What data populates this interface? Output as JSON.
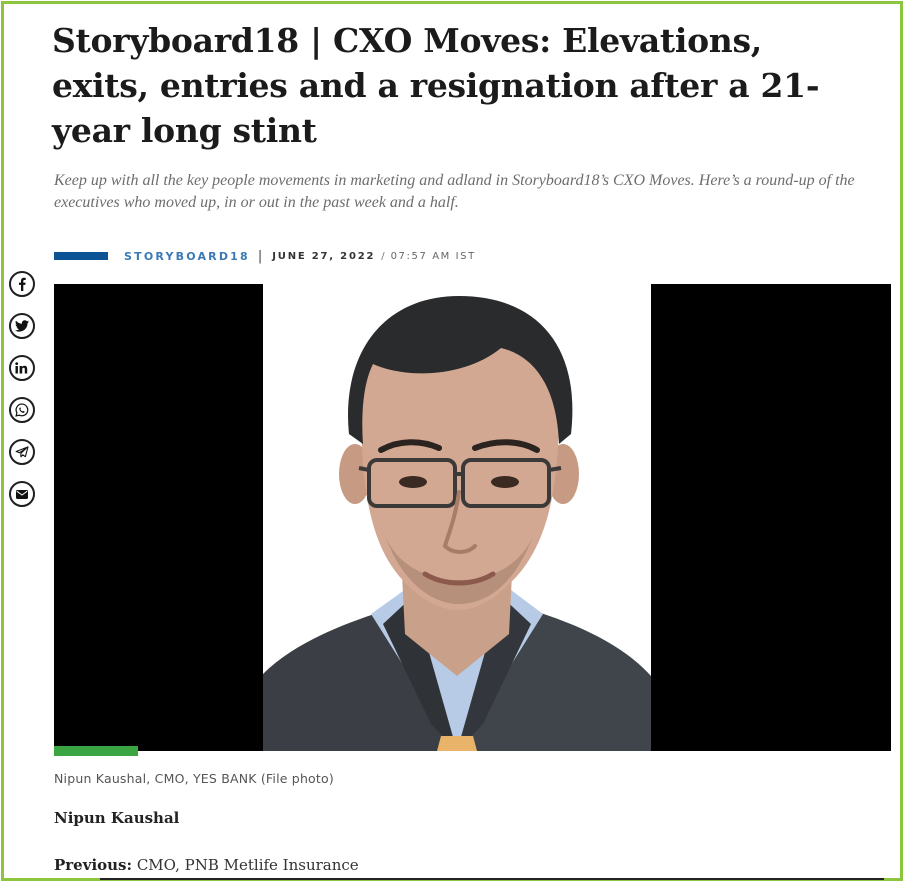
{
  "article": {
    "headline": "Storyboard18 | CXO Moves: Elevations, exits, entries and a resignation after a 21-year long stint",
    "dek": "Keep up with all the key people movements in marketing and adland in Storyboard18’s CXO Moves. Here’s a round-up of the executives who moved up, in or out in the past week and a half.",
    "source": "STORYBOARD18",
    "separator": "|",
    "date": "JUNE 27, 2022",
    "date_time_separator": "/",
    "time": "07:57 AM IST"
  },
  "share": {
    "items": [
      {
        "icon": "facebook-icon"
      },
      {
        "icon": "twitter-icon"
      },
      {
        "icon": "linkedin-icon"
      },
      {
        "icon": "whatsapp-icon"
      },
      {
        "icon": "telegram-icon"
      },
      {
        "icon": "email-icon"
      }
    ]
  },
  "media": {
    "caption": "Nipun Kaushal, CMO, YES BANK (File photo)",
    "progress_fraction": 0.1
  },
  "body": {
    "person_name": "Nipun Kaushal",
    "previous_label": "Previous:",
    "previous_value": "CMO, PNB Metlife Insurance"
  },
  "colors": {
    "frame_border": "#8cc63f",
    "accent_blue": "#0b5394",
    "source_link": "#3a79b6",
    "progress": "#3aa542"
  }
}
